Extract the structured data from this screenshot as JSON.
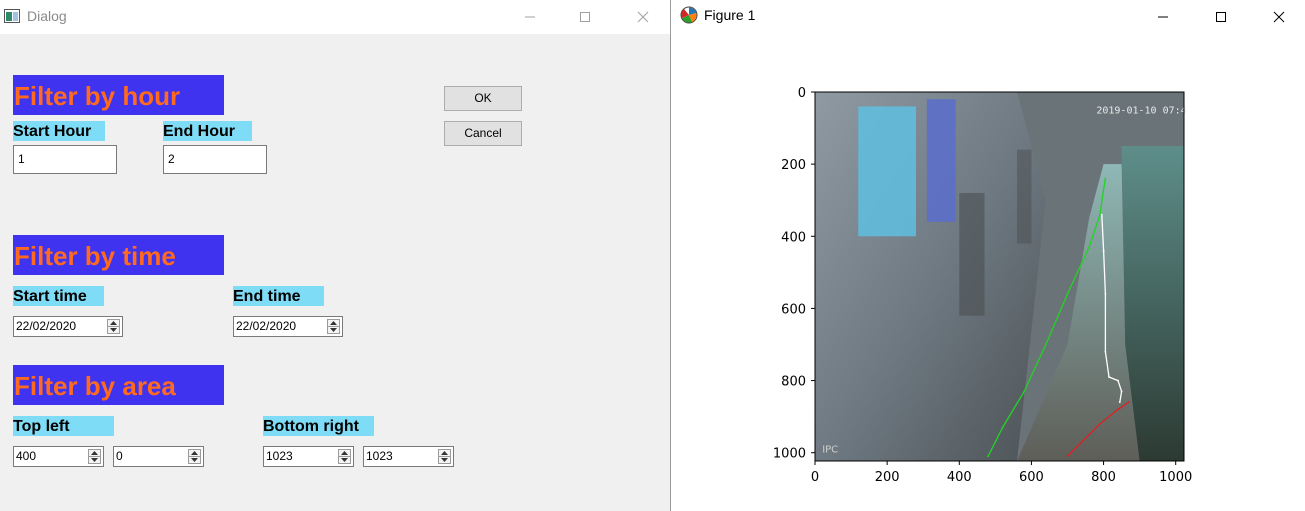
{
  "dialog": {
    "title": "Dialog",
    "ok_label": "OK",
    "cancel_label": "Cancel",
    "hour": {
      "heading": "Filter by hour",
      "start_label": "Start Hour",
      "end_label": "End Hour",
      "start_value": "1",
      "end_value": "2"
    },
    "time": {
      "heading": "Filter by time",
      "start_label": "Start time",
      "end_label": "End time",
      "start_value": "22/02/2020",
      "end_value": "22/02/2020"
    },
    "area": {
      "heading": "Filter by area",
      "top_left_label": "Top left",
      "bottom_right_label": "Bottom right",
      "top_left_x": "400",
      "top_left_y": "0",
      "bottom_right_x": "1023",
      "bottom_right_y": "1023"
    }
  },
  "figure": {
    "title": "Figure 1",
    "image_timestamp": "2019-01-10 07:4",
    "image_watermark": "IPC",
    "colors": {
      "heading_bg": "#3f33f0",
      "heading_text": "#ff6a1f",
      "label_bg": "#7fdcf6"
    },
    "chart_data": {
      "type": "scatter",
      "title": "",
      "xlabel": "",
      "ylabel": "",
      "xlim": [
        0,
        1023
      ],
      "ylim": [
        1023,
        0
      ],
      "xticks": [
        0,
        200,
        400,
        600,
        800,
        1000
      ],
      "yticks": [
        0,
        200,
        400,
        600,
        800,
        1000
      ],
      "series": [
        {
          "color": "#22d322",
          "x": [
            480,
            520,
            580,
            640,
            700,
            760,
            790,
            800,
            805
          ],
          "y": [
            1010,
            930,
            830,
            700,
            560,
            430,
            340,
            270,
            240
          ]
        },
        {
          "color": "#ffffff",
          "x": [
            795,
            800,
            805,
            805,
            815,
            840,
            850,
            845
          ],
          "y": [
            340,
            440,
            560,
            720,
            790,
            800,
            830,
            860
          ]
        },
        {
          "color": "#e02020",
          "x": [
            700,
            740,
            790,
            840,
            870
          ],
          "y": [
            1010,
            970,
            920,
            880,
            860
          ]
        }
      ]
    }
  }
}
